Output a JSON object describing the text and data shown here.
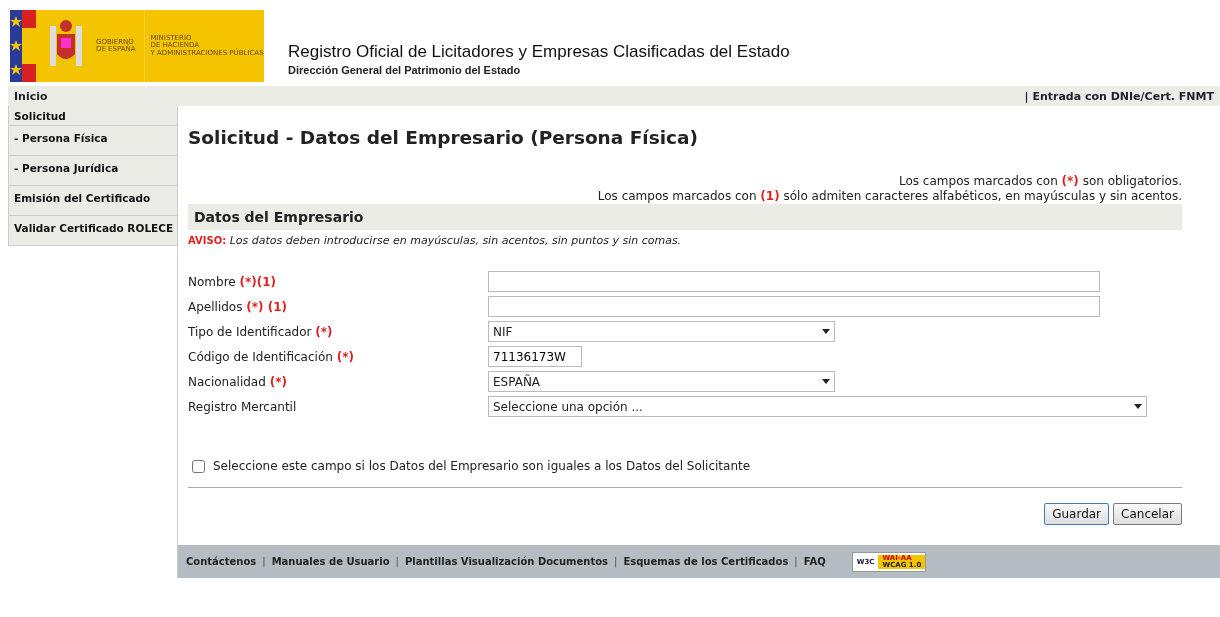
{
  "header": {
    "gov_lines": [
      "GOBIERNO",
      "DE ESPAÑA"
    ],
    "ministry_lines": [
      "MINISTERIO",
      "DE HACIENDA",
      "Y ADMINISTRACIONES PÚBLICAS"
    ],
    "title": "Registro Oficial de Licitadores y Empresas Clasificadas del Estado",
    "subtitle": "Dirección General del Patrimonio del Estado"
  },
  "topbar": {
    "home": "Inicio",
    "login": "| Entrada con DNIe/Cert. FNMT"
  },
  "sidebar": {
    "items": [
      {
        "label": "Solicitud",
        "selected": false,
        "children": [
          {
            "label": "- Persona Física",
            "selected": false
          },
          {
            "label": "- Persona Jurídica",
            "selected": false
          }
        ]
      },
      {
        "label": "Emisión del Certificado",
        "selected": false
      },
      {
        "label": "Validar Certificado ROLECE",
        "selected": false
      }
    ]
  },
  "page_title": "Solicitud - Datos del Empresario (Persona Física)",
  "notes": [
    {
      "before": "Los campos marcados con ",
      "mark": "(*)",
      "after": " son obligatorios."
    },
    {
      "before": "Los campos marcados con ",
      "mark": "(1)",
      "after": " sólo admiten caracteres alfabéticos, en mayúsculas y sin acentos."
    }
  ],
  "section": {
    "title": "Datos del Empresario",
    "warning_label": "AVISO:",
    "warning_text": "Los datos deben introducirse en mayúsculas, sin acentos, sin puntos y sin comas."
  },
  "fields": [
    {
      "label": "Nombre",
      "marks": "(*)(1)",
      "kind": "text"
    },
    {
      "label": "Apellidos",
      "marks": "(*) (1)",
      "kind": "text"
    },
    {
      "label": "Tipo de Identificador",
      "marks": "(*)",
      "kind": "select",
      "value": "NIF"
    },
    {
      "label": "Código de Identificación",
      "marks": "(*)",
      "kind": "text",
      "value": "71136173W"
    },
    {
      "label": "Nacionalidad",
      "marks": "(*)",
      "kind": "select",
      "value": "ESPAÑA"
    },
    {
      "label": "Registro Mercantil",
      "kind": "select",
      "value": "Seleccione una opción ..."
    }
  ],
  "same_as_applicant": {
    "label": "Seleccione este campo si los Datos del Empresario son iguales a los Datos del Solicitante",
    "checked": false
  },
  "buttons": [
    "Guardar",
    "Cancelar"
  ],
  "footer": {
    "items": [
      {
        "kind": "link",
        "text": "Contáctenos"
      },
      {
        "kind": "separator",
        "text": "|"
      },
      {
        "kind": "link",
        "text": "Manuales de Usuario"
      },
      {
        "kind": "separator",
        "text": "|"
      },
      {
        "kind": "link",
        "text": "Plantillas Visualización Documentos"
      },
      {
        "kind": "separator",
        "text": "|"
      },
      {
        "kind": "link",
        "text": "Esquemas de los Certificados"
      },
      {
        "kind": "separator",
        "text": "|"
      },
      {
        "kind": "link",
        "text": "FAQ"
      }
    ],
    "badge": {
      "left": "W3C",
      "top": "WAI-AA",
      "bottom": "WCAG 1.0"
    }
  }
}
